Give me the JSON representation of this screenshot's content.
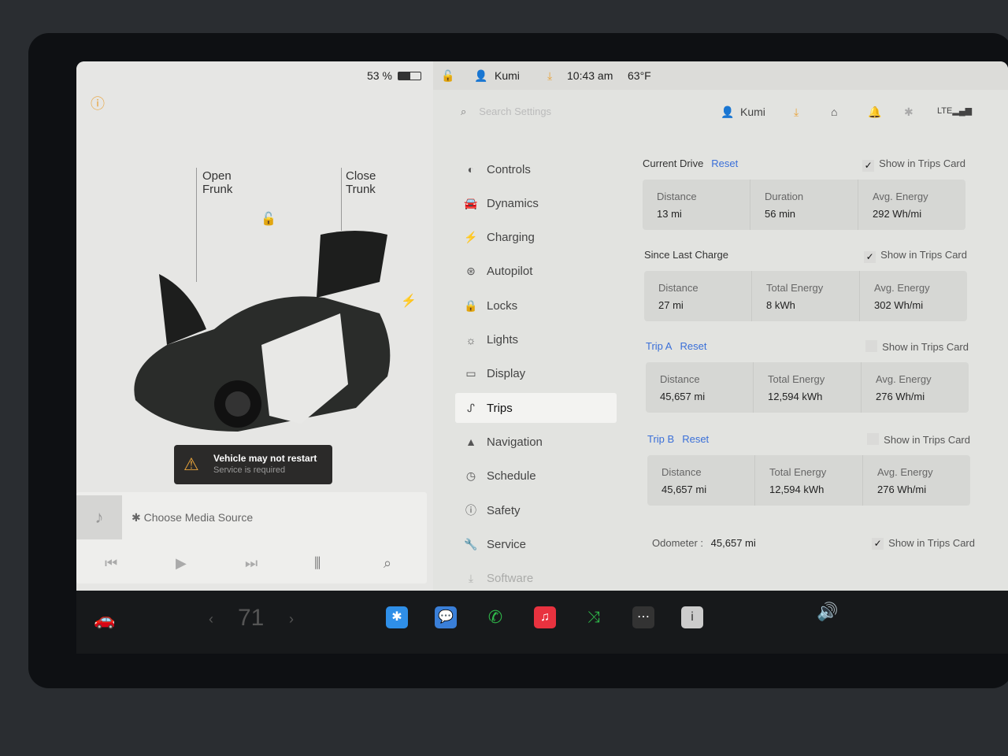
{
  "status": {
    "battery": "53 %",
    "user": "Kumi",
    "time": "10:43 am",
    "temp": "63°F"
  },
  "car": {
    "open_frunk": "Open\nFrunk",
    "close_trunk": "Close\nTrunk"
  },
  "alert": {
    "title": "Vehicle may not restart",
    "subtitle": "Service is required"
  },
  "media": {
    "source": "Choose Media Source"
  },
  "settings": {
    "search_placeholder": "Search Settings",
    "user": "Kumi",
    "nav": [
      {
        "label": "Controls",
        "icon": "toggle-icon"
      },
      {
        "label": "Dynamics",
        "icon": "car-icon"
      },
      {
        "label": "Charging",
        "icon": "bolt-icon"
      },
      {
        "label": "Autopilot",
        "icon": "steering-wheel-icon"
      },
      {
        "label": "Locks",
        "icon": "lock-icon"
      },
      {
        "label": "Lights",
        "icon": "sun-icon"
      },
      {
        "label": "Display",
        "icon": "display-icon"
      },
      {
        "label": "Trips",
        "icon": "trips-icon",
        "active": true
      },
      {
        "label": "Navigation",
        "icon": "navigation-icon"
      },
      {
        "label": "Schedule",
        "icon": "clock-icon"
      },
      {
        "label": "Safety",
        "icon": "info-icon"
      },
      {
        "label": "Service",
        "icon": "wrench-icon"
      },
      {
        "label": "Software",
        "icon": "download-icon"
      }
    ],
    "sections": [
      {
        "title": "Current Drive",
        "reset": "Reset",
        "show": "Show in Trips Card",
        "checked": true,
        "cells": [
          {
            "k": "Distance",
            "v": "13 mi"
          },
          {
            "k": "Duration",
            "v": "56 min"
          },
          {
            "k": "Avg. Energy",
            "v": "292 Wh/mi"
          }
        ]
      },
      {
        "title": "Since Last Charge",
        "reset": "",
        "show": "Show in Trips Card",
        "checked": true,
        "cells": [
          {
            "k": "Distance",
            "v": "27 mi"
          },
          {
            "k": "Total Energy",
            "v": "8 kWh"
          },
          {
            "k": "Avg. Energy",
            "v": "302 Wh/mi"
          }
        ]
      },
      {
        "title": "Trip A",
        "reset": "Reset",
        "show": "Show in Trips Card",
        "checked": false,
        "cells": [
          {
            "k": "Distance",
            "v": "45,657 mi"
          },
          {
            "k": "Total Energy",
            "v": "12,594 kWh"
          },
          {
            "k": "Avg. Energy",
            "v": "276 Wh/mi"
          }
        ]
      },
      {
        "title": "Trip B",
        "reset": "Reset",
        "show": "Show in Trips Card",
        "checked": false,
        "cells": [
          {
            "k": "Distance",
            "v": "45,657 mi"
          },
          {
            "k": "Total Energy",
            "v": "12,594 kWh"
          },
          {
            "k": "Avg. Energy",
            "v": "276 Wh/mi"
          }
        ]
      }
    ],
    "odometer_label": "Odometer :",
    "odometer_value": "45,657 mi",
    "odometer_show": "Show in Trips Card"
  },
  "bottombar": {
    "cabin_temp": "71"
  },
  "colors": {
    "accent": "#3a6fd8",
    "warning": "#e8a33a",
    "bluetooth": "#2f8fe8",
    "phone": "#2fb84a",
    "music": "#e8323f"
  }
}
